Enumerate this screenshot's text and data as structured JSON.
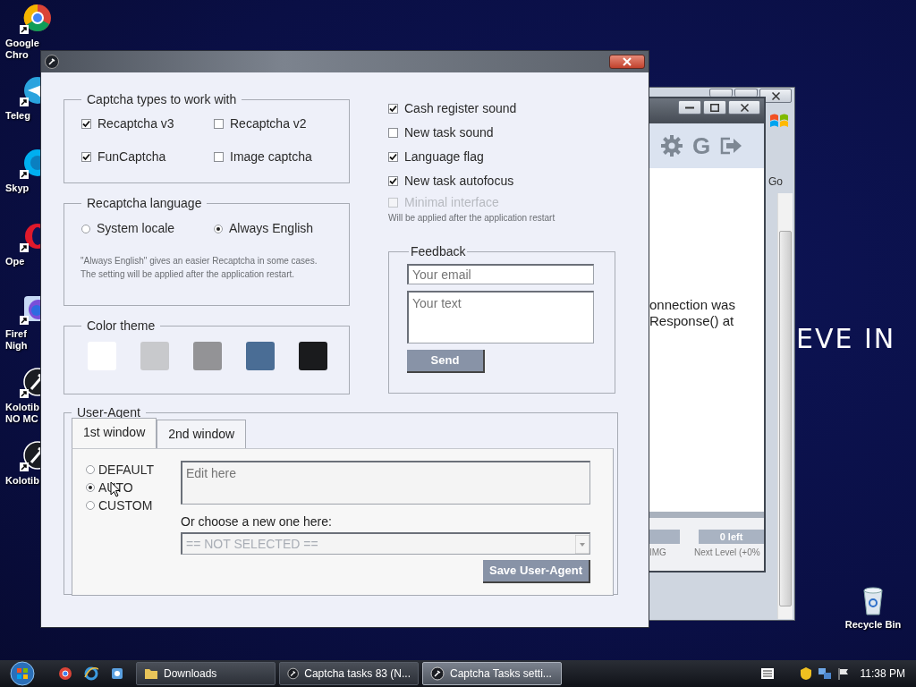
{
  "desktop": {
    "icons": [
      {
        "label": "Google\nChro"
      },
      {
        "label": "Teleg"
      },
      {
        "label": "Skyp"
      },
      {
        "label": "Ope"
      },
      {
        "label": "Firef\nNigh"
      },
      {
        "label": "Kolotib\nNO MC"
      },
      {
        "label": "Kolotib"
      }
    ],
    "wallpaper_text": "EVE IN",
    "recycle_bin": {
      "label": "Recycle Bin"
    }
  },
  "back_window": {
    "go_label": "Go"
  },
  "task_window": {
    "toolbar_glyph": "G",
    "message": "onnection was\nResponse() at",
    "progress_label": "0 left",
    "stat_labels": [
      "IMG",
      "Next Level (+0%"
    ]
  },
  "settings_window": {
    "captcha_types": {
      "title": "Captcha types to work with",
      "options": [
        {
          "label": "Recaptcha v3",
          "checked": true
        },
        {
          "label": "Recaptcha v2",
          "checked": false
        },
        {
          "label": "FunCaptcha",
          "checked": true
        },
        {
          "label": "Image captcha",
          "checked": false
        }
      ]
    },
    "recaptcha_language": {
      "title": "Recaptcha language",
      "options": [
        {
          "label": "System locale",
          "selected": false
        },
        {
          "label": "Always English",
          "selected": true
        }
      ],
      "note": "\"Always English\" gives an easier Recaptcha in some cases.\nThe setting will be applied after the application restart."
    },
    "color_theme": {
      "title": "Color theme",
      "swatches": [
        {
          "color": "#ffffff"
        },
        {
          "color": "#c8c9cc"
        },
        {
          "color": "#939396"
        },
        {
          "color": "#4a6d95"
        },
        {
          "color": "#1a1b1d"
        }
      ]
    },
    "options": [
      {
        "label": "Cash register sound",
        "checked": true,
        "disabled": false
      },
      {
        "label": "New task sound",
        "checked": false,
        "disabled": false
      },
      {
        "label": "Language flag",
        "checked": true,
        "disabled": false
      },
      {
        "label": "New task autofocus",
        "checked": true,
        "disabled": false
      },
      {
        "label": "Minimal interface",
        "checked": false,
        "disabled": true
      }
    ],
    "options_note": "Will be applied after the application restart",
    "feedback": {
      "title": "Feedback",
      "email_placeholder": "Your email",
      "text_placeholder": "Your text",
      "send": "Send"
    },
    "user_agent": {
      "title": "User-Agent",
      "tabs": [
        {
          "label": "1st window",
          "selected": true
        },
        {
          "label": "2nd window",
          "selected": false
        }
      ],
      "modes": [
        {
          "label": "DEFAULT",
          "selected": false
        },
        {
          "label": "AUTO",
          "selected": true
        },
        {
          "label": "CUSTOM",
          "selected": false
        }
      ],
      "edit_placeholder": "Edit here",
      "choose_label": "Or choose a new one here:",
      "select_value": "== NOT SELECTED ==",
      "save": "Save User-Agent"
    }
  },
  "taskbar": {
    "items": [
      {
        "label": "Downloads",
        "kind": "folder",
        "selected": false
      },
      {
        "label": "Captcha tasks 83 (N...",
        "kind": "app",
        "selected": false
      },
      {
        "label": "Captcha Tasks setti...",
        "kind": "app",
        "selected": true
      }
    ],
    "clock": "11:38 PM"
  }
}
